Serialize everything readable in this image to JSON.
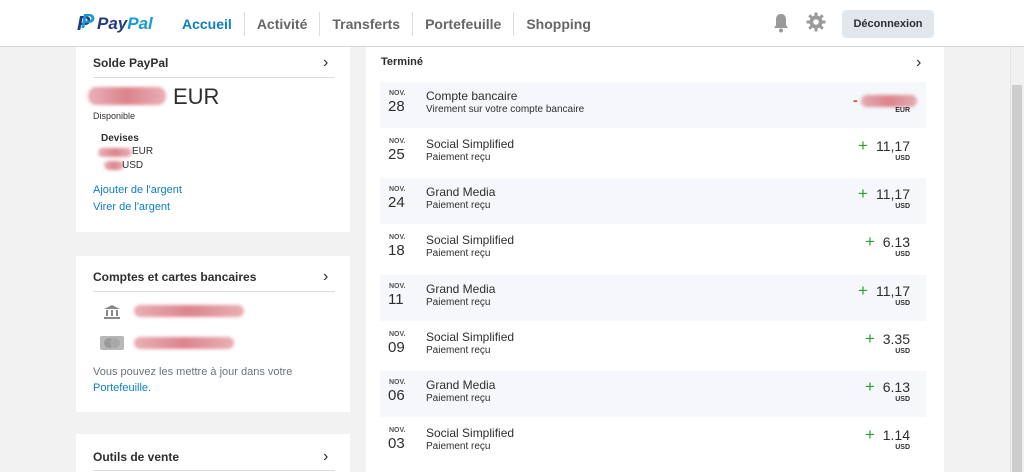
{
  "header": {
    "logo_pay": "Pay",
    "logo_pal": "Pal",
    "nav": [
      "Accueil",
      "Activité",
      "Transferts",
      "Portefeuille",
      "Shopping"
    ],
    "logout_label": "Déconnexion",
    "icons": [
      "bell-icon",
      "gear-icon"
    ]
  },
  "balance": {
    "title": "Solde PayPal",
    "currency": "EUR",
    "available_label": "Disponible",
    "currencies_title": "Devises",
    "currencies": [
      "EUR",
      "USD"
    ],
    "add_money": "Ajouter de l'argent",
    "withdraw": "Virer de l'argent"
  },
  "banks": {
    "title": "Comptes et cartes bancaires",
    "note_line1": "Vous pouvez les mettre à jour dans votre",
    "note_link": "Portefeuille."
  },
  "tools": {
    "title": "Outils de vente"
  },
  "activity": {
    "title": "Terminé",
    "transactions": [
      {
        "month": "NOV.",
        "day": "28",
        "name": "Compte bancaire",
        "desc": "Virement sur votre compte bancaire",
        "sign": "-",
        "amount": "",
        "currency": "EUR"
      },
      {
        "month": "NOV.",
        "day": "25",
        "name": "Social Simplified",
        "desc": "Paiement reçu",
        "sign": "+",
        "amount": "11,17",
        "currency": "USD"
      },
      {
        "month": "NOV.",
        "day": "24",
        "name": "Grand Media",
        "desc": "Paiement reçu",
        "sign": "+",
        "amount": "11,17",
        "currency": "USD"
      },
      {
        "month": "NOV.",
        "day": "18",
        "name": "Social Simplified",
        "desc": "Paiement reçu",
        "sign": "+",
        "amount": "6.13",
        "currency": "USD"
      },
      {
        "month": "NOV.",
        "day": "11",
        "name": "Grand Media",
        "desc": "Paiement reçu",
        "sign": "+",
        "amount": "11,17",
        "currency": "USD"
      },
      {
        "month": "NOV.",
        "day": "09",
        "name": "Social Simplified",
        "desc": "Paiement reçu",
        "sign": "+",
        "amount": "3.35",
        "currency": "USD"
      },
      {
        "month": "NOV.",
        "day": "06",
        "name": "Grand Media",
        "desc": "Paiement reçu",
        "sign": "+",
        "amount": "6.13",
        "currency": "USD"
      },
      {
        "month": "NOV.",
        "day": "03",
        "name": "Social Simplified",
        "desc": "Paiement reçu",
        "sign": "+",
        "amount": "1.14",
        "currency": "USD"
      }
    ]
  },
  "colors": {
    "brand_dark": "#253b80",
    "brand_light": "#179bd7",
    "link": "#0e7dc3",
    "positive": "#2e9e3a",
    "negative": "#d04a27"
  }
}
